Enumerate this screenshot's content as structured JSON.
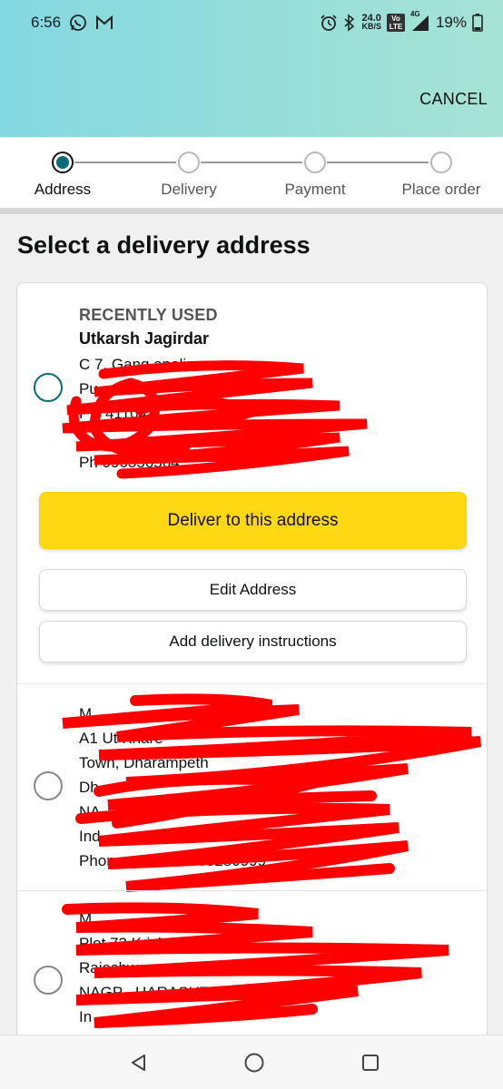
{
  "status_bar": {
    "time": "6:56",
    "net_speed_value": "24.0",
    "net_speed_unit": "KB/S",
    "battery": "19%",
    "volte": "Vo LTE",
    "network": "4G"
  },
  "header": {
    "cancel_label": "CANCEL"
  },
  "steps": [
    {
      "label": "Address",
      "active": true
    },
    {
      "label": "Delivery",
      "active": false
    },
    {
      "label": "Payment",
      "active": false
    },
    {
      "label": "Place order",
      "active": false
    }
  ],
  "page": {
    "title": "Select a delivery address"
  },
  "selected_address": {
    "tag": "RECENTLY USED",
    "name": "Utkarsh Jagirdar",
    "lines": [
      "C 7,   Gang   apolis",
      "Pu",
      "P       y         411047",
      "Ph          096356564"
    ],
    "deliver_button": "Deliver to this address",
    "edit_button": "Edit Address",
    "instructions_button": "Add delivery instructions"
  },
  "address_2": {
    "lines": [
      "M",
      "A1 Ut                                     Khare",
      "Town, Dharampeth",
      "Dh",
      "NA      , MAHARA",
      "Ind",
      "Phone nu    ber: 9765280999"
    ]
  },
  "address_3": {
    "lines": [
      "M",
      "Plot 73 Krish      ency 3",
      "Rajeshwar   ,           oad, Manish Nagar",
      "NAGP      ,  HARASHTR",
      "In"
    ]
  },
  "colors": {
    "accent_teal": "#0a6b7a",
    "primary_button": "#ffd814",
    "redaction": "#ff0000"
  },
  "icons": {
    "whatsapp": "whatsapp-icon",
    "gmail": "gmail-icon",
    "alarm": "alarm-icon",
    "bluetooth": "bluetooth-icon",
    "signal": "signal-icon",
    "battery": "battery-icon",
    "back": "back-triangle-icon",
    "home": "home-circle-icon",
    "recents": "recents-square-icon"
  }
}
